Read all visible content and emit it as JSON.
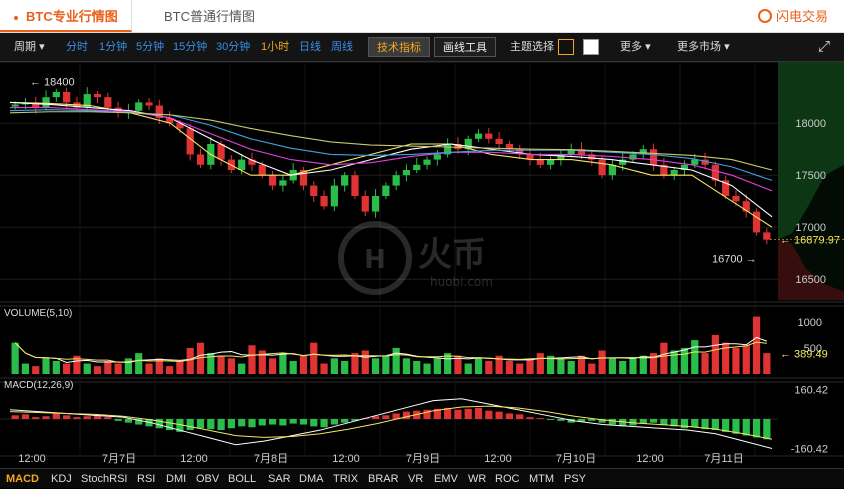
{
  "tabs": [
    {
      "label": "BTC专业行情图",
      "active": true
    },
    {
      "label": "BTC普通行情图",
      "active": false
    }
  ],
  "brand": "闪电交易",
  "toolbar": {
    "period_label": "周期",
    "intervals": [
      {
        "label": "分时",
        "active": false
      },
      {
        "label": "1分钟",
        "active": false
      },
      {
        "label": "5分钟",
        "active": false
      },
      {
        "label": "15分钟",
        "active": false
      },
      {
        "label": "30分钟",
        "active": false
      },
      {
        "label": "1小时",
        "active": true
      },
      {
        "label": "日线",
        "active": false
      },
      {
        "label": "周线",
        "active": false
      }
    ],
    "indicators_button": "技术指标",
    "drawing_button": "画线工具",
    "theme_label": "主题选择",
    "more_label": "更多",
    "more_markets_label": "更多市场"
  },
  "watermark": {
    "text": "火币",
    "sub": "huobi.com"
  },
  "colors": {
    "up": "#2bbd4a",
    "down": "#e03434",
    "accent": "#f5a623",
    "link": "#3a8ee6"
  },
  "chart_data": {
    "type": "candlestick",
    "interval": "1h",
    "x_labels": [
      "12:00",
      "7月7日",
      "12:00",
      "7月8日",
      "12:00",
      "7月9日",
      "12:00",
      "7月10日",
      "12:00",
      "7月11日"
    ],
    "price": {
      "ylim": [
        16300,
        18550
      ],
      "ticks": [
        18000,
        17500,
        17000,
        16500
      ],
      "last_price": "16879.97",
      "annotations": [
        {
          "text": "18400"
        },
        {
          "text": "16700"
        }
      ],
      "close_path": [
        18180,
        18200,
        18150,
        18250,
        18300,
        18200,
        18150,
        18280,
        18250,
        18150,
        18100,
        18120,
        18200,
        18170,
        18050,
        18000,
        17950,
        17700,
        17600,
        17800,
        17650,
        17550,
        17650,
        17600,
        17500,
        17400,
        17450,
        17550,
        17400,
        17300,
        17200,
        17400,
        17500,
        17300,
        17150,
        17300,
        17400,
        17500,
        17550,
        17600,
        17650,
        17700,
        17800,
        17750,
        17850,
        17900,
        17850,
        17800,
        17750,
        17700,
        17650,
        17600,
        17650,
        17700,
        17750,
        17700,
        17650,
        17500,
        17600,
        17650,
        17700,
        17750,
        17600,
        17500,
        17550,
        17600,
        17650,
        17600,
        17450,
        17300,
        17250,
        17150,
        16950,
        16880
      ],
      "moving_averages": [
        {
          "color": "#f5e663",
          "values": [
            18200,
            18190,
            18170,
            18100,
            18000,
            17700,
            17500,
            17500,
            17600,
            17700,
            17800,
            17800,
            17700,
            17650,
            17650,
            17600,
            17500,
            17500,
            17250,
            17000
          ]
        },
        {
          "color": "#ffffff",
          "values": [
            18200,
            18180,
            18150,
            18120,
            18050,
            17850,
            17650,
            17500,
            17550,
            17650,
            17750,
            17800,
            17750,
            17700,
            17680,
            17650,
            17600,
            17550,
            17400,
            17100
          ]
        },
        {
          "color": "#e040e0",
          "values": [
            18150,
            18150,
            18130,
            18110,
            18050,
            17900,
            17750,
            17650,
            17600,
            17620,
            17680,
            17720,
            17720,
            17700,
            17700,
            17680,
            17650,
            17600,
            17500,
            17350
          ]
        },
        {
          "color": "#40a0e0",
          "values": [
            18120,
            18130,
            18120,
            18100,
            18080,
            17980,
            17850,
            17760,
            17700,
            17690,
            17700,
            17720,
            17740,
            17740,
            17740,
            17720,
            17700,
            17660,
            17580,
            17450
          ]
        },
        {
          "color": "#c8c870",
          "values": [
            18100,
            18110,
            18110,
            18100,
            18080,
            18030,
            17950,
            17880,
            17820,
            17790,
            17780,
            17770,
            17760,
            17750,
            17745,
            17730,
            17710,
            17690,
            17650,
            17550
          ]
        }
      ]
    },
    "volume": {
      "label": "VOLUME(5,10)",
      "ticks": [
        1000,
        500
      ],
      "last_value": "389.49",
      "ylim": [
        0,
        1150
      ],
      "values": [
        600,
        200,
        150,
        300,
        250,
        200,
        350,
        200,
        150,
        250,
        200,
        300,
        400,
        200,
        300,
        150,
        250,
        500,
        600,
        400,
        350,
        300,
        200,
        550,
        450,
        300,
        400,
        250,
        350,
        600,
        200,
        300,
        250,
        400,
        450,
        300,
        350,
        500,
        300,
        250,
        200,
        300,
        400,
        350,
        200,
        300,
        250,
        350,
        250,
        200,
        300,
        400,
        350,
        300,
        250,
        350,
        200,
        450,
        300,
        250,
        300,
        350,
        400,
        600,
        450,
        500,
        650,
        400,
        750,
        600,
        500,
        550,
        1100,
        400
      ]
    },
    "macd": {
      "label": "MACD(12,26,9)",
      "ticks": [
        160.42,
        -160.42
      ],
      "ylim": [
        -190,
        190
      ],
      "histogram": [
        20,
        25,
        10,
        15,
        30,
        20,
        10,
        15,
        20,
        10,
        -10,
        -20,
        -30,
        -40,
        -50,
        -60,
        -70,
        -60,
        -50,
        -55,
        -60,
        -50,
        -40,
        -45,
        -35,
        -30,
        -35,
        -25,
        -30,
        -40,
        -45,
        -30,
        -20,
        -10,
        5,
        15,
        20,
        30,
        40,
        45,
        50,
        55,
        60,
        50,
        55,
        60,
        45,
        40,
        30,
        25,
        10,
        5,
        -5,
        -10,
        -20,
        -15,
        -10,
        -20,
        -30,
        -40,
        -35,
        -25,
        -20,
        -30,
        -40,
        -50,
        -45,
        -55,
        -60,
        -70,
        -80,
        -90,
        -100,
        -110
      ],
      "dif": [
        50,
        40,
        30,
        20,
        10,
        -20,
        -60,
        -100,
        -140,
        -120,
        -90,
        -60,
        -20,
        20,
        60,
        100,
        110,
        80,
        50,
        20,
        -10,
        -30,
        -40,
        -50,
        -60,
        -80,
        -120,
        -160
      ],
      "dea": [
        40,
        35,
        30,
        25,
        15,
        -5,
        -30,
        -60,
        -90,
        -100,
        -95,
        -80,
        -55,
        -25,
        10,
        45,
        65,
        70,
        60,
        40,
        15,
        -5,
        -20,
        -30,
        -40,
        -55,
        -80,
        -110
      ]
    }
  },
  "indicators": [
    {
      "label": "MACD",
      "active": true
    },
    {
      "label": "KDJ",
      "active": false
    },
    {
      "label": "StochRSI",
      "active": false
    },
    {
      "label": "RSI",
      "active": false
    },
    {
      "label": "DMI",
      "active": false
    },
    {
      "label": "OBV",
      "active": false
    },
    {
      "label": "BOLL",
      "active": false
    },
    {
      "label": "SAR",
      "active": false
    },
    {
      "label": "DMA",
      "active": false
    },
    {
      "label": "TRIX",
      "active": false
    },
    {
      "label": "BRAR",
      "active": false
    },
    {
      "label": "VR",
      "active": false
    },
    {
      "label": "EMV",
      "active": false
    },
    {
      "label": "WR",
      "active": false
    },
    {
      "label": "ROC",
      "active": false
    },
    {
      "label": "MTM",
      "active": false
    },
    {
      "label": "PSY",
      "active": false
    }
  ]
}
